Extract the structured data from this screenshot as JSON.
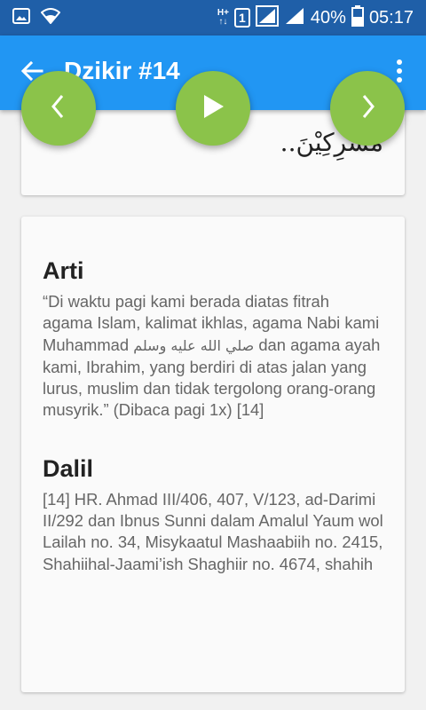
{
  "status_bar": {
    "net_type_top": "H+",
    "net_type_bottom": "↑↓",
    "sim": "1",
    "battery": "40%",
    "time": "05:17"
  },
  "app_bar": {
    "title": "Dzikir #14",
    "color": "#2196f3"
  },
  "fab": {
    "color": "#8bc34a",
    "prev_icon": "chevron-left",
    "play_icon": "play",
    "next_icon": "chevron-right"
  },
  "top_card": {
    "arabic_fragment": "مُشْرِكِيْنَ.."
  },
  "arti": {
    "heading": "Arti",
    "text_before": "“Di waktu pagi kami berada diatas fitrah agama Islam, kalimat ikhlas, agama Nabi kami Muhammad ",
    "arabic": "صلي الله عليه وسلم",
    "text_after": " dan agama ayah kami, Ibrahim, yang berdiri di atas jalan yang lurus, muslim dan tidak tergolong orang-orang musyrik.” (Dibaca pagi 1x) [14]"
  },
  "dalil": {
    "heading": "Dalil",
    "text": "[14] HR. Ahmad III/406, 407, V/123, ad-Darimi II/292 dan Ibnus Sunni dalam Amalul Yaum wol Lailah no. 34, Misykaatul Mashaabiih no. 2415, Shahiihal-Jaami’ish Shaghiir no. 4674, shahih"
  }
}
